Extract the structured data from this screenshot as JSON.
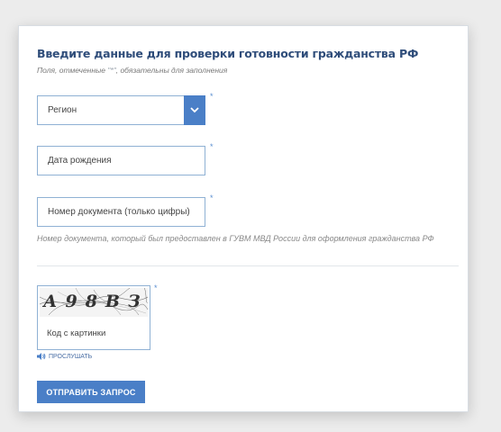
{
  "form": {
    "title": "Введите данные для проверки готовности гражданства РФ",
    "hint_prefix": "Поля, отмеченные ",
    "hint_asterisk": "\"*\"",
    "hint_suffix": ", обязательны для заполнения",
    "region": {
      "value": "Регион",
      "required_mark": "*"
    },
    "birth_date": {
      "placeholder": "Дата рождения",
      "required_mark": "*"
    },
    "document_number": {
      "placeholder": "Номер документа (только цифры)",
      "required_mark": "*"
    },
    "document_note": "Номер документа, который был предоставлен в ГУВМ МВД России для оформления гражданства РФ",
    "captcha": {
      "image_text": "А98ВЗ",
      "placeholder": "Код с картинки",
      "required_mark": "*",
      "listen_label": "ПРОСЛУШАТЬ"
    },
    "submit_label": "ОТПРАВИТЬ ЗАПРОС"
  },
  "colors": {
    "accent": "#4a7fc7",
    "title": "#2f4d7a",
    "border": "#8fb1d4"
  },
  "icons": {
    "select": "chevron-down-icon",
    "listen": "speaker-icon"
  }
}
